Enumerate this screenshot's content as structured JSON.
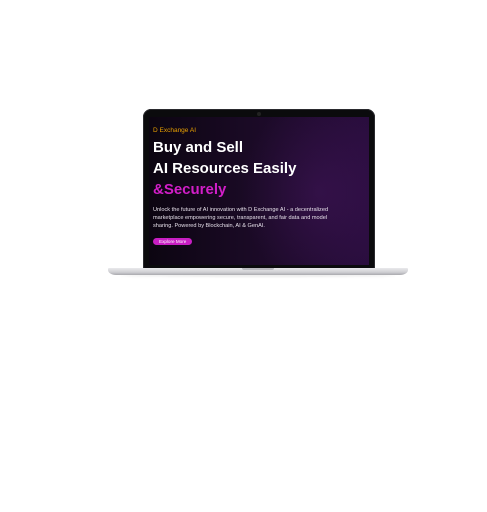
{
  "hero": {
    "brand": "D Exchange AI",
    "headline_line1": "Buy and Sell",
    "headline_line2": "AI Resources Easily",
    "headline_accent": "&Securely",
    "description": "Unlock the future of AI innovation with D Exchange AI - a decentralized marketplace empowering secure, transparent, and fair data and model sharing. Powered by Blockchain, AI & GenAI.",
    "cta_label": "Explore More"
  },
  "colors": {
    "brand": "#e8a000",
    "accent": "#d21ec8",
    "button": "#c81ec3",
    "screen_bg": "#1a0a25"
  }
}
